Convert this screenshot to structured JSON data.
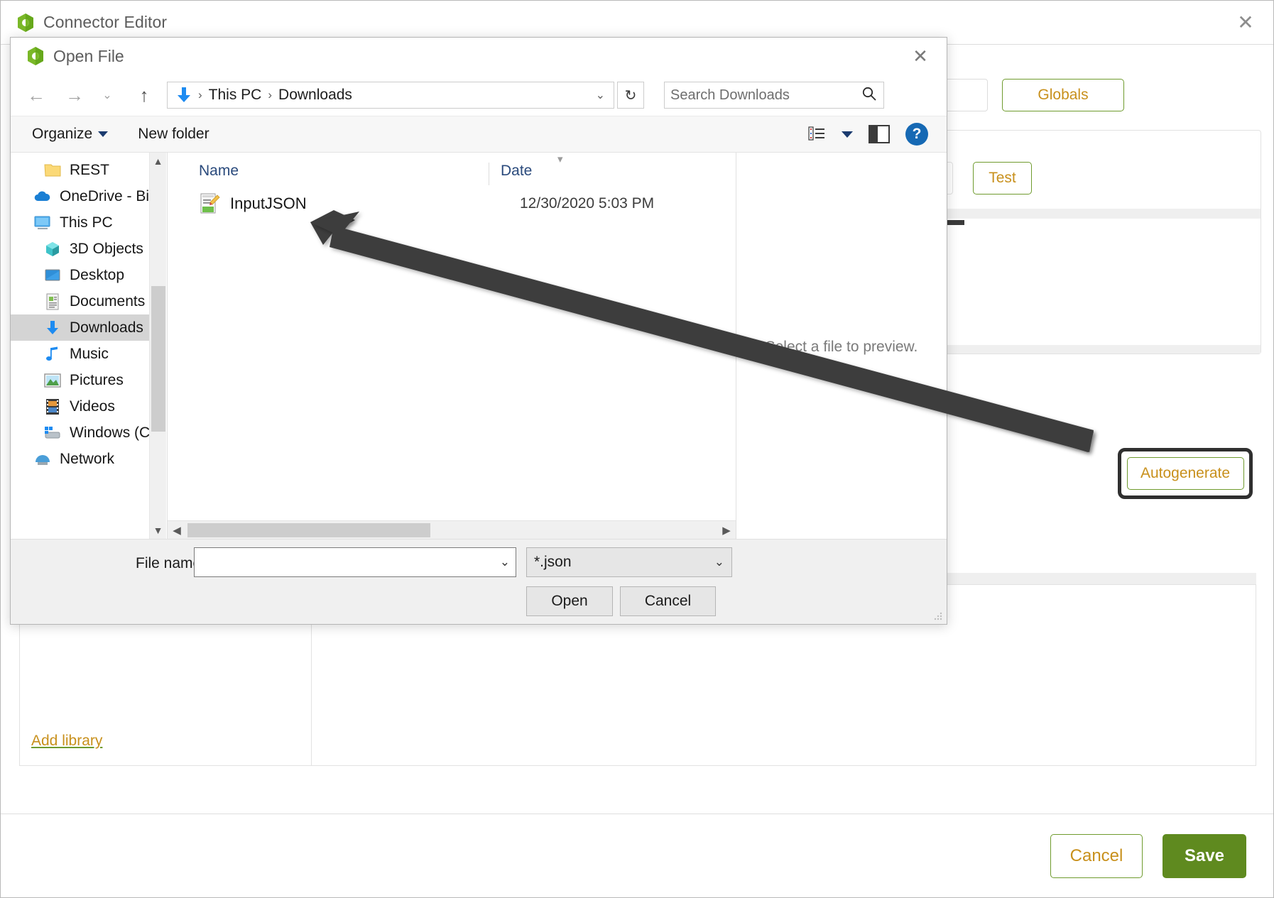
{
  "app": {
    "title": "Connector Editor",
    "close_label": "✕",
    "globals_button": "Globals",
    "test_button": "Test",
    "autogenerate_button": "Autogenerate",
    "add_library_link": "Add library",
    "cancel_button": "Cancel",
    "save_button": "Save",
    "accent_green": "#5f8a1f",
    "accent_gold": "#c8901c"
  },
  "dialog": {
    "title": "Open File",
    "close_label": "✕",
    "nav": {
      "back": "←",
      "forward": "→",
      "recent": "⌄",
      "up": "↑",
      "refresh": "↻",
      "breadcrumb_chevron": "⌄"
    },
    "breadcrumb": {
      "items": [
        "This PC",
        "Downloads"
      ],
      "separator": "›"
    },
    "search": {
      "placeholder": "Search Downloads",
      "icon": "🔍"
    },
    "commandbar": {
      "organize": "Organize",
      "new_folder": "New folder",
      "help": "?"
    },
    "nav_tree": [
      {
        "label": "REST",
        "icon": "folder-icon",
        "indent": 1,
        "selected": false
      },
      {
        "label": "OneDrive - Bizagi",
        "icon": "onedrive-icon",
        "indent": 0,
        "selected": false
      },
      {
        "label": "This PC",
        "icon": "this-pc-icon",
        "indent": 0,
        "selected": false
      },
      {
        "label": "3D Objects",
        "icon": "3d-objects-icon",
        "indent": 1,
        "selected": false
      },
      {
        "label": "Desktop",
        "icon": "desktop-icon",
        "indent": 1,
        "selected": false
      },
      {
        "label": "Documents",
        "icon": "documents-icon",
        "indent": 1,
        "selected": false
      },
      {
        "label": "Downloads",
        "icon": "downloads-icon",
        "indent": 1,
        "selected": true
      },
      {
        "label": "Music",
        "icon": "music-icon",
        "indent": 1,
        "selected": false
      },
      {
        "label": "Pictures",
        "icon": "pictures-icon",
        "indent": 1,
        "selected": false
      },
      {
        "label": "Videos",
        "icon": "videos-icon",
        "indent": 1,
        "selected": false
      },
      {
        "label": "Windows (C:)",
        "icon": "drive-icon",
        "indent": 1,
        "selected": false
      },
      {
        "label": "Network",
        "icon": "network-icon",
        "indent": 0,
        "selected": false
      }
    ],
    "list": {
      "columns": [
        "Name",
        "Date"
      ],
      "rows": [
        {
          "name": "InputJSON",
          "date": "12/30/2020 5:03 PM",
          "icon": "json-file-icon"
        }
      ]
    },
    "preview": {
      "empty_text": "Select a file to preview."
    },
    "footer": {
      "filename_label": "File name:",
      "filename_value": "",
      "filename_placeholder": "",
      "filetype_value": "*.json",
      "open_button": "Open",
      "cancel_button": "Cancel"
    }
  }
}
